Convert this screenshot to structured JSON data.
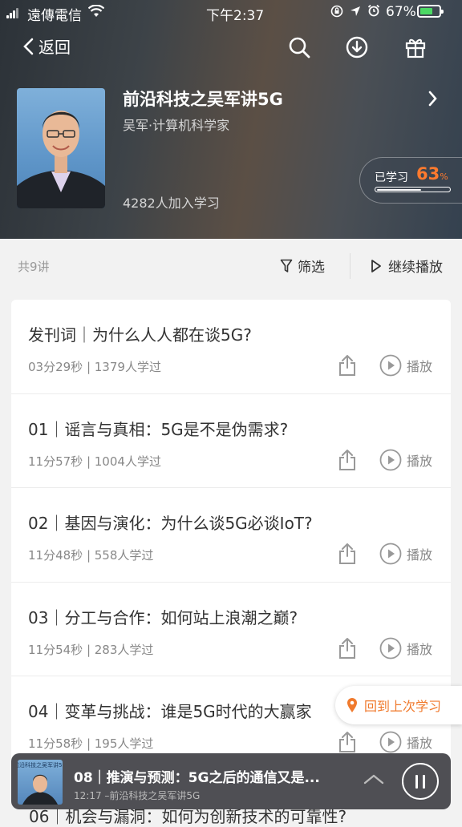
{
  "status_bar": {
    "carrier": "遠傳電信",
    "time": "下午2:37",
    "battery": "67%",
    "battery_level": 0.67
  },
  "nav": {
    "back_label": "返回"
  },
  "course": {
    "title": "前沿科技之吴军讲5G",
    "author": "吴军·计算机科学家",
    "learners": "4282人加入学习",
    "progress_label": "已学习",
    "progress_value": "63",
    "progress_unit": "%",
    "progress_fraction": 0.63
  },
  "toolbar": {
    "total": "共9讲",
    "filter_label": "筛选",
    "continue_label": "继续播放"
  },
  "lessons": [
    {
      "title": "发刊词｜为什么人人都在谈5G?",
      "meta": "03分29秒 | 1379人学过",
      "play_label": "播放"
    },
    {
      "title": "01｜谣言与真相：5G是不是伪需求?",
      "meta": "11分57秒 | 1004人学过",
      "play_label": "播放"
    },
    {
      "title": "02｜基因与演化：为什么谈5G必谈IoT?",
      "meta": "11分48秒 | 558人学过",
      "play_label": "播放"
    },
    {
      "title": "03｜分工与合作：如何站上浪潮之巅?",
      "meta": "11分54秒 | 283人学过",
      "play_label": "播放"
    },
    {
      "title": "04｜变革与挑战：谁是5G时代的大赢家",
      "meta": "11分58秒 | 195人学过",
      "play_label": "播放"
    }
  ],
  "resume_label": "回到上次学习",
  "player": {
    "title": "08｜推演与预测：5G之后的通信又是...",
    "subtitle": "12:17  –前沿科技之吴军讲5G",
    "thumb_caption": "前沿科技之吴军讲5G"
  },
  "hidden_row": "06｜机会与漏洞：如何为创新技术的可靠性?"
}
